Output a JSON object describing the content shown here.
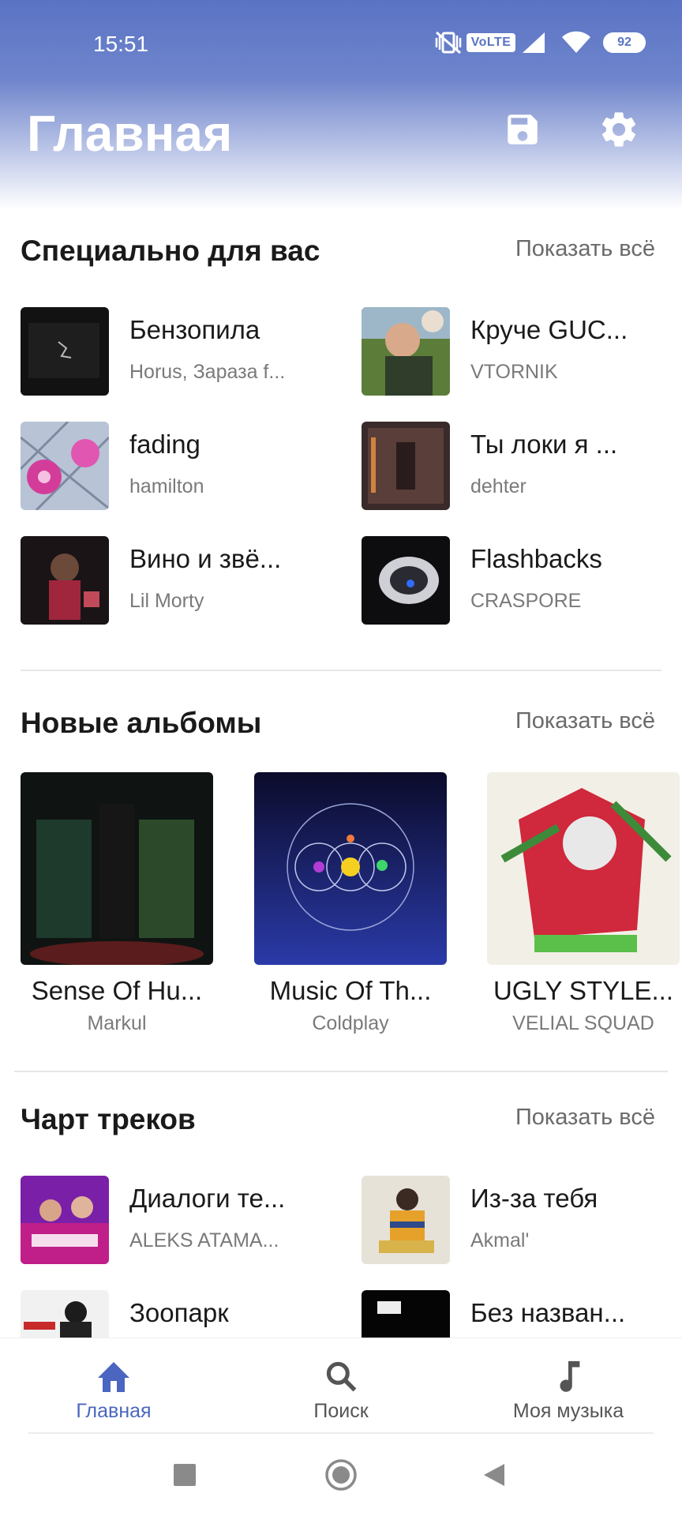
{
  "status_bar": {
    "time": "15:51",
    "volte": "VoLTE",
    "battery": "92",
    "icons": [
      "vibrate-off-icon",
      "volte-icon",
      "signal-icon",
      "wifi-icon",
      "battery-icon"
    ]
  },
  "appbar": {
    "title": "Главная",
    "actions": [
      "save-icon",
      "settings-gear-icon"
    ]
  },
  "for_you": {
    "title": "Специально для вас",
    "show_all": "Показать всё",
    "tracks": [
      {
        "title": "Бензопила",
        "artist": "Horus, Зараза f..."
      },
      {
        "title": "Круче GUC...",
        "artist": "VTORNIK"
      },
      {
        "title": "fading",
        "artist": "hamilton"
      },
      {
        "title": "Ты локи я ...",
        "artist": "dehter"
      },
      {
        "title": "Вино и звё...",
        "artist": "Lil Morty"
      },
      {
        "title": "Flashbacks",
        "artist": "CRASPORE"
      }
    ]
  },
  "new_albums": {
    "title": "Новые альбомы",
    "show_all": "Показать всё",
    "albums": [
      {
        "title": "Sense Of Hu...",
        "artist": "Markul"
      },
      {
        "title": "Music Of Th...",
        "artist": "Coldplay"
      },
      {
        "title": "UGLY STYLE...",
        "artist": "VELIAL SQUAD"
      }
    ]
  },
  "chart": {
    "title": "Чарт треков",
    "show_all": "Показать всё",
    "tracks": [
      {
        "title": "Диалоги те...",
        "artist": "ALEKS ATAMA..."
      },
      {
        "title": "Из-за тебя",
        "artist": "Akmal'"
      },
      {
        "title": "Зоопарк",
        "artist": ""
      },
      {
        "title": "Без назван...",
        "artist": ""
      }
    ]
  },
  "bottom_nav": {
    "items": [
      {
        "label": "Главная",
        "icon": "home-icon",
        "active": true
      },
      {
        "label": "Поиск",
        "icon": "search-icon",
        "active": false
      },
      {
        "label": "Моя музыка",
        "icon": "music-note-icon",
        "active": false
      }
    ]
  },
  "colors": {
    "accent": "#4a66c0",
    "header_gradient_top": "#5a73c4",
    "text_primary": "#1a1a1a",
    "text_secondary": "#7a7a7a"
  }
}
